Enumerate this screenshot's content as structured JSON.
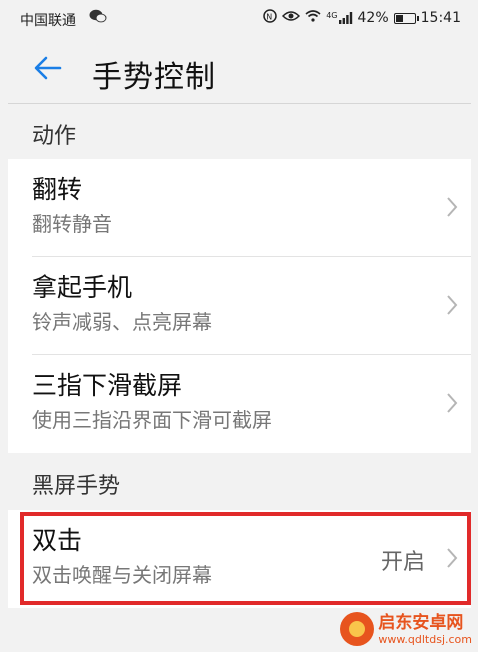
{
  "status_bar": {
    "carrier": "中国联通",
    "icons": [
      "wechat-icon",
      "nfc-icon",
      "eye-icon",
      "wifi-icon",
      "signal-icon"
    ],
    "network": "4G",
    "battery_text": "42%",
    "battery_level": 0.42,
    "time": "15:41"
  },
  "app_bar": {
    "back_icon": "arrow-left-icon",
    "title": "手势控制",
    "accent": "#1a7ee6"
  },
  "sections": [
    {
      "header": "动作",
      "items": [
        {
          "title": "翻转",
          "subtitle": "翻转静音"
        },
        {
          "title": "拿起手机",
          "subtitle": "铃声减弱、点亮屏幕"
        },
        {
          "title": "三指下滑截屏",
          "subtitle": "使用三指沿界面下滑可截屏"
        }
      ]
    },
    {
      "header": "黑屏手势",
      "items": [
        {
          "title": "双击",
          "subtitle": "双击唤醒与关闭屏幕",
          "value": "开启"
        }
      ]
    }
  ],
  "highlight_color": "#e12a2a",
  "watermark": {
    "title": "启东安卓网",
    "url": "www.qdltdsj.com"
  }
}
